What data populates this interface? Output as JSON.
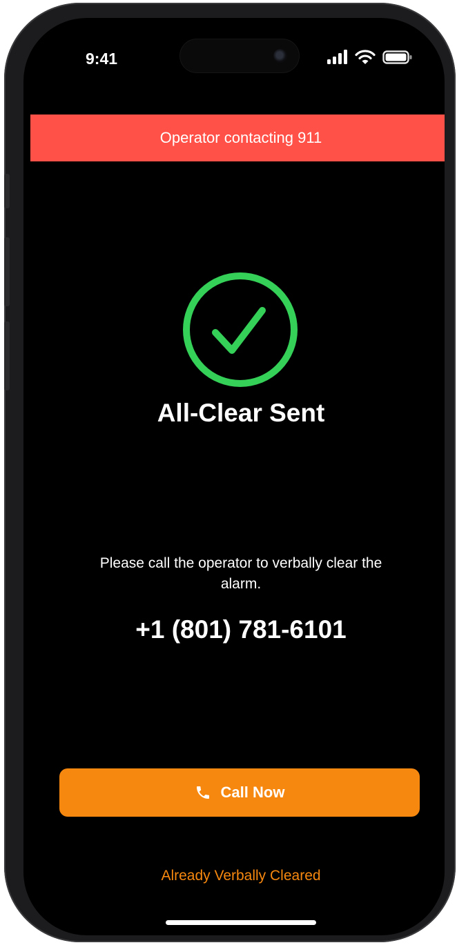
{
  "status_bar": {
    "time": "9:41",
    "icons": [
      "cellular-signal-icon",
      "wifi-icon",
      "battery-icon"
    ]
  },
  "banner": {
    "text": "Operator contacting 911",
    "color": "#ff5148"
  },
  "status": {
    "icon": "checkmark-circle-icon",
    "title": "All-Clear Sent",
    "accent_color": "#34d058"
  },
  "instructions": {
    "text": "Please call the operator to verbally clear the alarm.",
    "phone_number": "+1 (801) 781-6101"
  },
  "actions": {
    "call_icon": "phone-icon",
    "call_label": "Call Now",
    "call_color": "#f7880f",
    "secondary_label": "Already Verbally Cleared"
  }
}
